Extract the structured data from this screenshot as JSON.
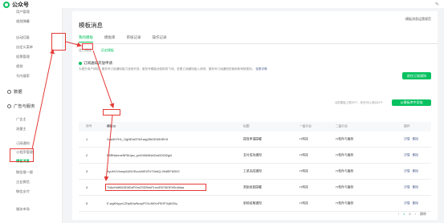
{
  "topbar": {
    "app_name": "公众号",
    "right_icon": "pin-icon"
  },
  "sidebar": {
    "items_top": [
      "用户管理",
      "视频弹幕"
    ],
    "items_mid": [
      "自动回复",
      "自定义菜单",
      "投票管理",
      "视频",
      "号内搜索"
    ],
    "group_data": "数据",
    "group_ads": "广告与服务",
    "items_ads": [
      "广告主",
      "流量主"
    ],
    "items_service": [
      "订阅通知",
      "小程序管理",
      "模板消息",
      "微信搜一搜",
      "企业微信",
      "微信支付"
    ],
    "items_bottom": [
      "服务市场"
    ]
  },
  "main": {
    "title": "模板消息",
    "help": "模板消息运营规范",
    "tabs": [
      "我的模板",
      "模板库",
      "审核记录",
      "操作记录"
    ],
    "subtabs": [
      "类目模板",
      "历史模板"
    ]
  },
  "notice": {
    "title": "订阅通知开放申请",
    "text": "为提升用户体验，服务号订阅通知能力逐渐开放，服务号模板消息即将下线。查看订阅通知接入说明，服务号订阅通知的使用和审核规则。",
    "link": "查看详情",
    "button": "前往订阅通知"
  },
  "table": {
    "count_text": "当前模板上限25个，你还可以添加19个",
    "add_button": "从模板库中添加",
    "headers": [
      "序号",
      "模板ID",
      "标题",
      "一级行业",
      "二级行业",
      "操作"
    ],
    "rows": [
      {
        "no": "1",
        "id": "Gad4H7H1_OgNEIa0TW1arjyZ8iGE6SHBY6",
        "title": "提现申请提醒",
        "ind1": "IT科技",
        "ind2": "IT软件与服务",
        "ops": [
          "详情",
          "删除"
        ]
      },
      {
        "no": "2",
        "id": "E9RNahmeNP6Upw_pnXh5tX6NAZsdX0032gl4",
        "title": "支付成功通知",
        "ind1": "IT科技",
        "ind2": "IT软件与服务",
        "ops": [
          "详情",
          "删除"
        ]
      },
      {
        "no": "3",
        "id": "AyuIH1VlumpAUNVEuv4AtSXFsTXbdQ-0fn8EFM3X2",
        "title": "工单完成通知",
        "ind1": "IT科技",
        "ind2": "IT软件与服务",
        "ops": [
          "详情",
          "删除"
        ]
      },
      {
        "no": "4",
        "id": "7NbzHdWW3D6DsPOm2SDRekP1mzR973tOEH5uIIdaa",
        "title": "奖励发放提醒",
        "ind1": "IT科技",
        "ind2": "IT软件与服务",
        "ops": [
          "详情",
          "删除"
        ]
      },
      {
        "no": "5",
        "id": "E-wgKNyyvLZNp5UwNusyPOIL4MXoF5OPJqNG5q",
        "title": "审核结果通知",
        "ind1": "IT科技",
        "ind2": "IT软件与服务",
        "ops": [
          "详情",
          "删除"
        ]
      }
    ],
    "pager": {
      "prev": "‹",
      "current": "1",
      "total": "2",
      "next": "›",
      "jump": "跳转"
    }
  },
  "colors": {
    "accent": "#07c160",
    "annotation": "#e53935",
    "link": "#576b95"
  }
}
